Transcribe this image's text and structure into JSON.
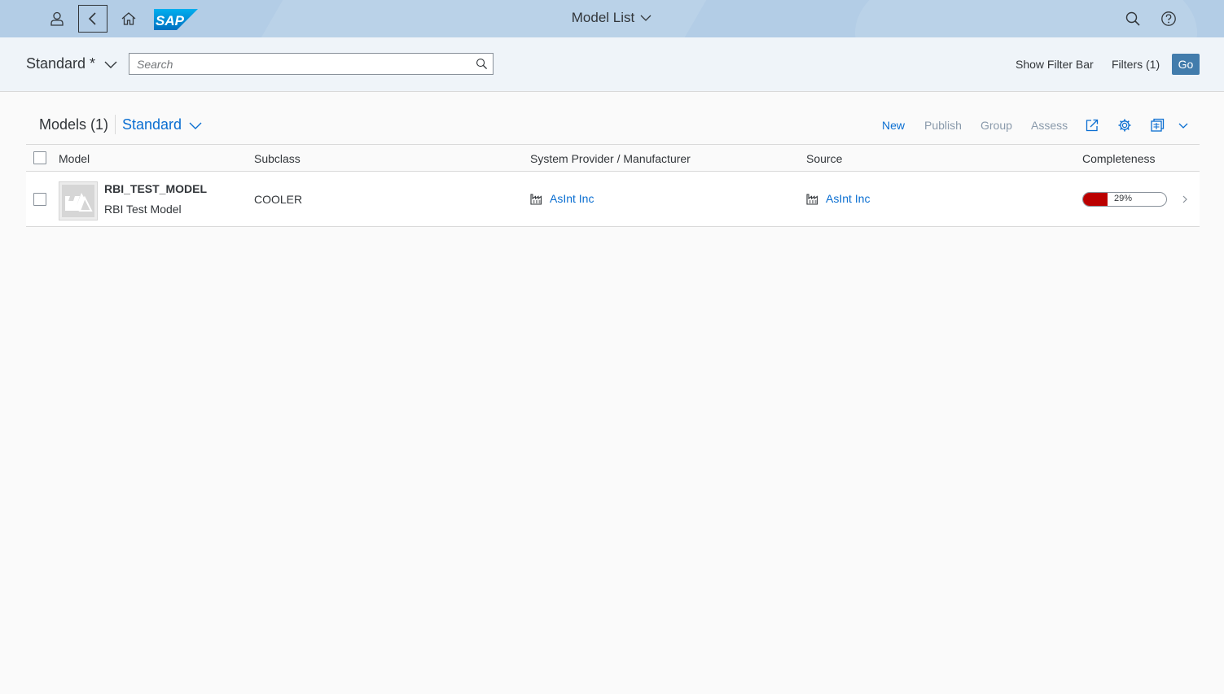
{
  "shell": {
    "title": "Model List",
    "logo_text": "SAP",
    "icons": [
      "user-icon",
      "back-icon",
      "home-icon",
      "search-icon",
      "help-icon"
    ]
  },
  "filter_bar": {
    "variant": "Standard *",
    "search_placeholder": "Search",
    "show_filter_bar": "Show Filter Bar",
    "filters": "Filters (1)",
    "go": "Go"
  },
  "table": {
    "title": "Models (1)",
    "variant": "Standard",
    "toolbar": {
      "new": "New",
      "publish": "Publish",
      "group": "Group",
      "assess": "Assess"
    },
    "columns": [
      "Model",
      "Subclass",
      "System Provider / Manufacturer",
      "Source",
      "Completeness"
    ],
    "rows": [
      {
        "model_id": "RBI_TEST_MODEL",
        "model_desc": "RBI Test Model",
        "subclass": "COOLER",
        "provider": "AsInt Inc",
        "source": "AsInt Inc",
        "completeness": 29,
        "completeness_label": "29%"
      }
    ]
  },
  "colors": {
    "shell_bg": "#b3cde6",
    "header_bg": "#eff4f9",
    "link": "#0a6ed1",
    "go_button": "#427cac",
    "progress_fill": "#bb0000"
  }
}
